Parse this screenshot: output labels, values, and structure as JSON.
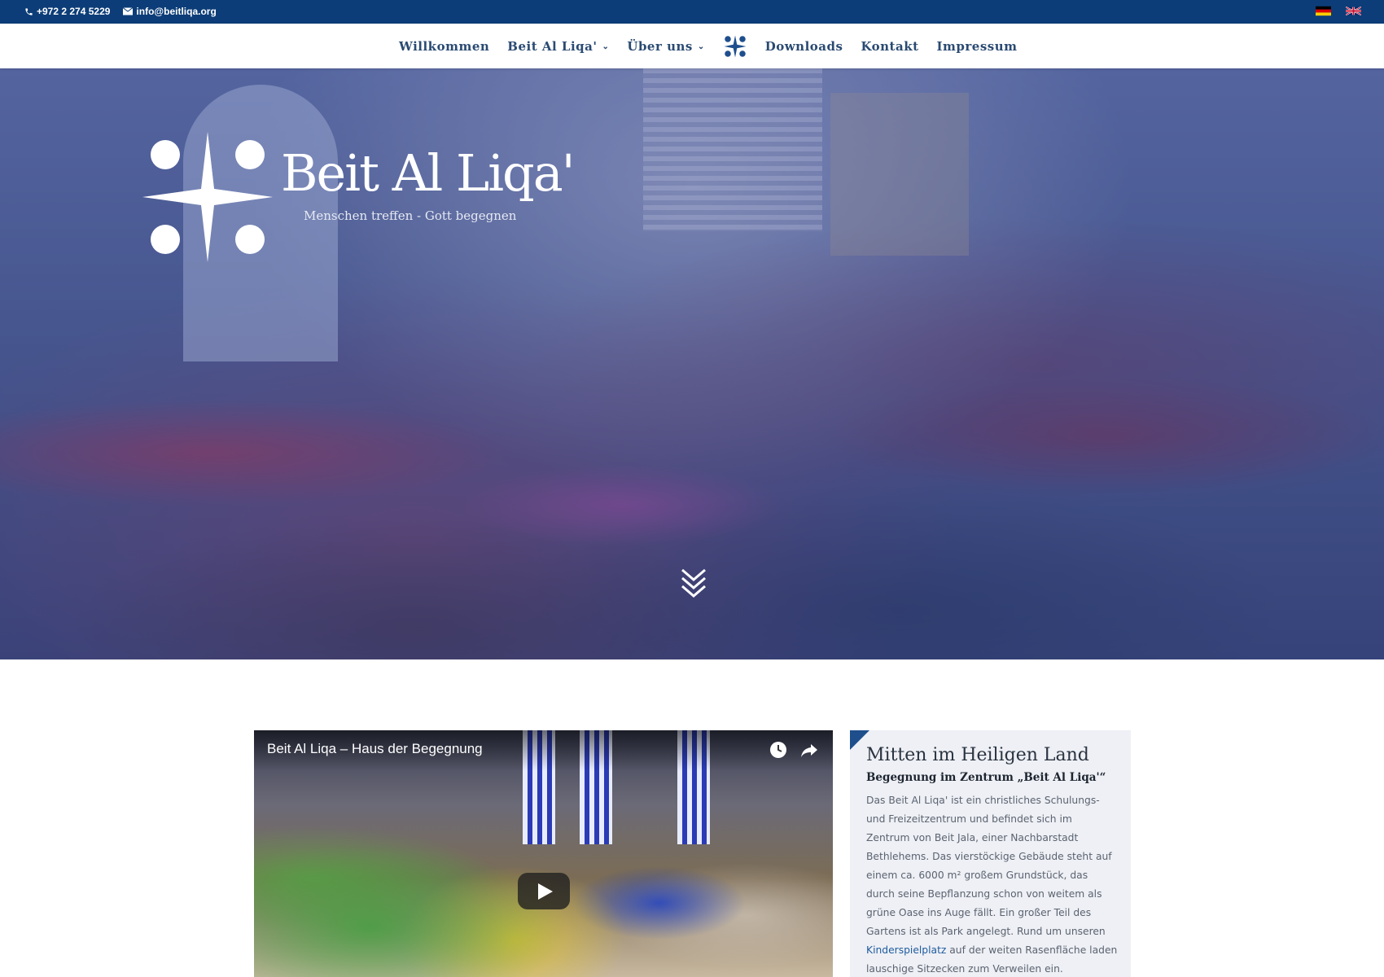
{
  "topbar": {
    "phone": "+972 2 274 5229",
    "email": "info@beitliqa.org",
    "languages": [
      "de",
      "en"
    ]
  },
  "nav": {
    "items": [
      {
        "label": "Willkommen",
        "dropdown": false
      },
      {
        "label": "Beit Al Liqa'",
        "dropdown": true
      },
      {
        "label": "Über uns",
        "dropdown": true
      },
      {
        "label": "Downloads",
        "dropdown": false
      },
      {
        "label": "Kontakt",
        "dropdown": false
      },
      {
        "label": "Impressum",
        "dropdown": false
      }
    ]
  },
  "hero": {
    "brand": "Beit Al Liqa'",
    "tagline": "Menschen treffen - Gott begegnen"
  },
  "video": {
    "title": "Beit Al Liqa – Haus der Begegnung"
  },
  "card": {
    "heading": "Mitten im Heiligen Land",
    "subheading": "Begegnung im Zentrum „Beit Al Liqa'“",
    "body_before_link": "Das Beit Al Liqa' ist ein christliches Schulungs- und Freizeitzentrum und befindet sich im Zentrum von Beit Jala, einer Nachbarstadt Bethlehems. Das vierstöckige Gebäude steht auf einem ca. 6000 m² großem Grundstück, das durch seine Bepflanzung schon von weitem als grüne Oase ins Auge fällt. Ein großer Teil des Gartens ist als Park angelegt. Rund um unseren ",
    "link": "Kinderspielplatz",
    "body_after_link": " auf der weiten Rasenfläche laden lauschige Sitzecken zum Verweilen ein."
  },
  "colors": {
    "topbar": "#0c3d78",
    "nav_text": "#2a4a72",
    "accent": "#1e4e8c",
    "link": "#1e5a9e"
  }
}
